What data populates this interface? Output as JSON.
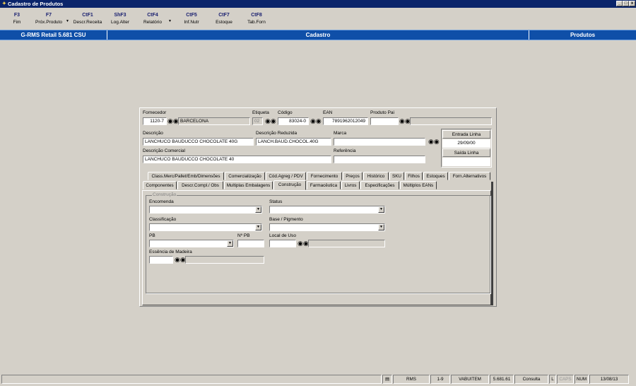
{
  "window": {
    "title": "Cadastro de Produtos",
    "controls": [
      "_",
      "□",
      "x"
    ]
  },
  "toolbar": [
    {
      "key": "F3",
      "label": "Fim"
    },
    {
      "key": "F7",
      "label": "Próx.Produto"
    },
    {
      "key": "CtF1",
      "label": "Descr.Receita"
    },
    {
      "key": "ShF3",
      "label": "Log.Alter"
    },
    {
      "key": "CtF4",
      "label": "Relatório"
    },
    {
      "key": "CtF5",
      "label": "Inf.Nutr"
    },
    {
      "key": "CtF7",
      "label": "Estoque"
    },
    {
      "key": "CtF8",
      "label": "Tab.Forn"
    }
  ],
  "header": {
    "app": "G-RMS Retail 5.681 CSU",
    "section": "Cadastro",
    "module": "Produtos"
  },
  "form": {
    "fornecedor_label": "Fornecedor",
    "fornecedor_code": "1120-7",
    "fornecedor_name": "BARCELONA",
    "etiqueta_label": "Etiqueta",
    "etiqueta_value": "02",
    "codigo_label": "Código",
    "codigo_value": "83024-0",
    "ean_label": "EAN",
    "ean_value": "7891962012049",
    "produto_pai_label": "Produto Pai",
    "produto_pai_value": "",
    "descricao_label": "Descrição",
    "descricao_value": "LANCHUCO BAUDUCCO CHOCOLATE 40G",
    "descricao_reduzida_label": "Descrição Reduzida",
    "descricao_reduzida_value": "LANCH.BAUD.CHOCOL.40G",
    "marca_label": "Marca",
    "marca_value": "",
    "descricao_comercial_label": "Descrição Comercial",
    "descricao_comercial_value": "LANCHUCO BAUDUCCO CHOCOLATE 40",
    "referencia_label": "Referência",
    "referencia_value": "",
    "entrada_linha_label": "Entrada Linha",
    "entrada_linha_value": "29/09/00",
    "saida_linha_label": "Saída Linha",
    "saida_linha_value": ""
  },
  "tabs_row1": [
    "Class.Merc/Pallet/Emb/Dimensões",
    "Comercialização",
    "Cód.Agreg / PDV",
    "Fornecimento",
    "Preços",
    "Histórico",
    "SKU",
    "Filhos",
    "Estoques",
    "Forn.Alternativos"
  ],
  "tabs_row2": [
    "Componentes",
    "Descr.Compl./ Obs",
    "Multiplas Embalagens",
    "Construção",
    "Farmacêutica",
    "Livros",
    "Especificações",
    "Múltiplos EANs"
  ],
  "active_tab": "Construção",
  "construcao": {
    "group_title": "Construção",
    "encomenda_label": "Encomenda",
    "encomenda_value": "",
    "status_label": "Status",
    "status_value": "",
    "classificacao_label": "Classificação",
    "classificacao_value": "",
    "base_label": "Base / Pigmento",
    "base_value": "",
    "pb_label": "PB",
    "pb_value": "",
    "npb_label": "Nº PB",
    "npb_value": "",
    "local_uso_label": "Local de Uso",
    "local_uso_code": "",
    "local_uso_desc": "",
    "essencia_label": "Essência de Madeira",
    "essencia_code": "",
    "essencia_desc": ""
  },
  "statusbar": {
    "system": "RMS",
    "range": "1-9",
    "user": "VABUITEM",
    "version": "5.681.61",
    "mode": "Consulta",
    "l": "L",
    "caps": "CAPS",
    "num": "NUM",
    "date": "13/08/13"
  },
  "icons": {
    "app": "cube-icon",
    "lookup": "binoculars-icon",
    "dropdown": "chevron-down-icon",
    "clipboard": "clipboard-icon"
  },
  "colors": {
    "titlebar": "#0a246a",
    "header": "#0f4fa8",
    "window_bg": "#d4d0c8"
  }
}
